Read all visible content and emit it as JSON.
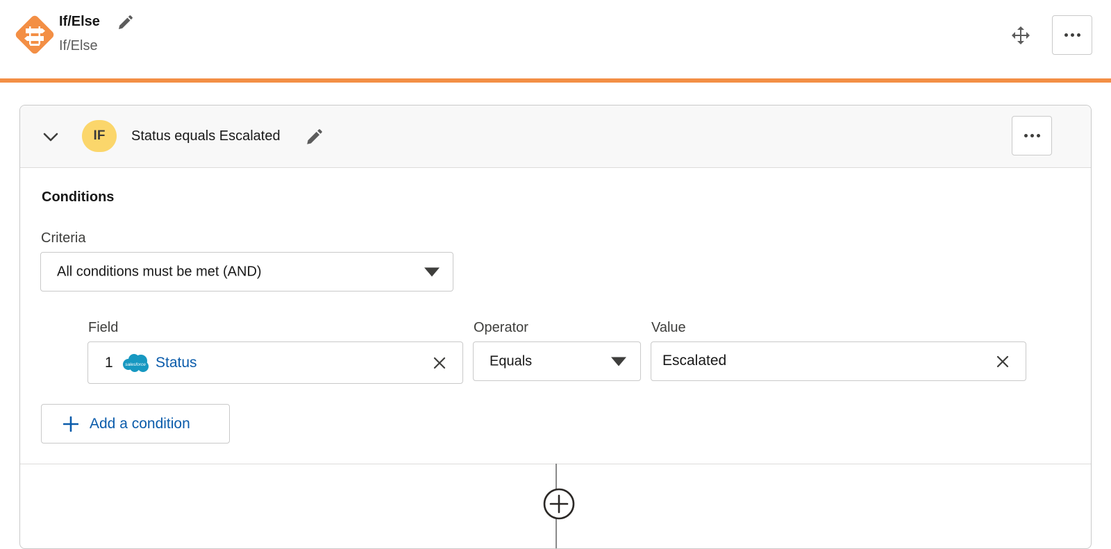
{
  "header": {
    "title": "If/Else",
    "subtitle": "If/Else",
    "accent_color": "#f38f45"
  },
  "branch": {
    "badge": "IF",
    "badge_color": "#fbd66b",
    "summary": "Status equals Escalated",
    "conditions_heading": "Conditions",
    "criteria": {
      "label": "Criteria",
      "selected": "All conditions must be met (AND)"
    },
    "condition_row": {
      "field_label": "Field",
      "operator_label": "Operator",
      "value_label": "Value",
      "index": "1",
      "field_value": "Status",
      "operator_value": "Equals",
      "value": "Escalated"
    },
    "add_condition_label": "Add a condition"
  },
  "icons": {
    "node": "branch-signpost-icon",
    "edit": "pencil-icon",
    "move": "move-arrows-icon",
    "menu": "more-dots-icon",
    "collapse": "chevron-down-icon",
    "clear": "close-icon",
    "source": "salesforce-cloud-icon",
    "add": "plus-icon",
    "add_step": "plus-circle-icon"
  },
  "link_color": "#0b5cab"
}
